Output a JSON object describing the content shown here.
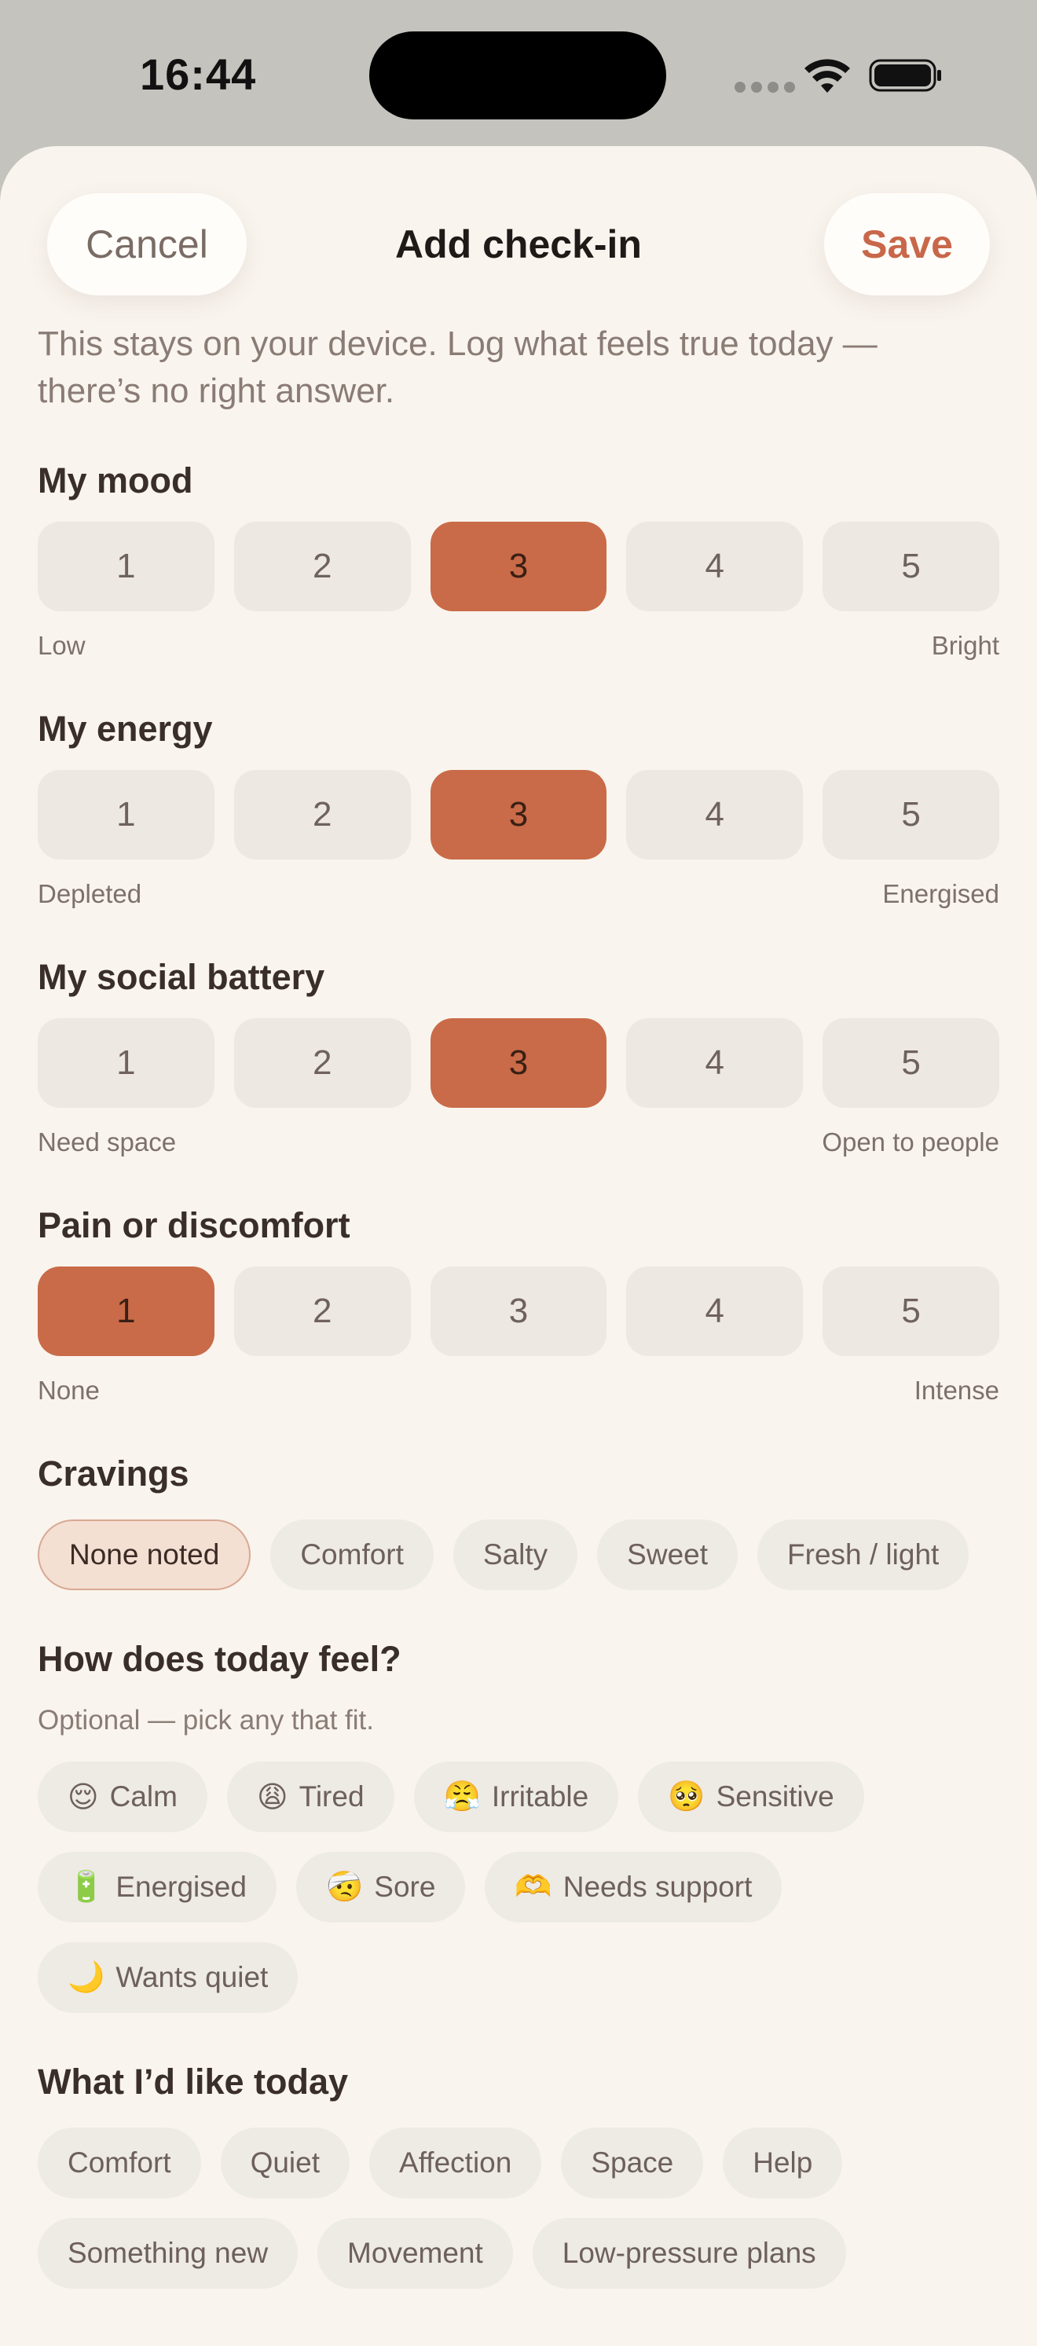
{
  "status_bar": {
    "time": "16:44"
  },
  "header": {
    "cancel_label": "Cancel",
    "title": "Add check-in",
    "save_label": "Save"
  },
  "intro": "This stays on your device. Log what feels true today — there’s no right answer.",
  "scales": {
    "mood": {
      "title": "My mood",
      "options": [
        "1",
        "2",
        "3",
        "4",
        "5"
      ],
      "selected": 3,
      "low_label": "Low",
      "high_label": "Bright"
    },
    "energy": {
      "title": "My energy",
      "options": [
        "1",
        "2",
        "3",
        "4",
        "5"
      ],
      "selected": 3,
      "low_label": "Depleted",
      "high_label": "Energised"
    },
    "social": {
      "title": "My social battery",
      "options": [
        "1",
        "2",
        "3",
        "4",
        "5"
      ],
      "selected": 3,
      "low_label": "Need space",
      "high_label": "Open to people"
    },
    "pain": {
      "title": "Pain or discomfort",
      "options": [
        "1",
        "2",
        "3",
        "4",
        "5"
      ],
      "selected": 1,
      "low_label": "None",
      "high_label": "Intense"
    }
  },
  "cravings": {
    "title": "Cravings",
    "options": [
      "None noted",
      "Comfort",
      "Salty",
      "Sweet",
      "Fresh / light"
    ],
    "selected": "None noted"
  },
  "feelings": {
    "title": "How does today feel?",
    "hint": "Optional — pick any that fit.",
    "options": [
      {
        "emoji": "😌",
        "label": "Calm"
      },
      {
        "emoji": "😩",
        "label": "Tired"
      },
      {
        "emoji": "😤",
        "label": "Irritable"
      },
      {
        "emoji": "🥺",
        "label": "Sensitive"
      },
      {
        "emoji": "🔋",
        "label": "Energised"
      },
      {
        "emoji": "🤕",
        "label": "Sore"
      },
      {
        "emoji": "🫶",
        "label": "Needs support"
      },
      {
        "emoji": "🌙",
        "label": "Wants quiet"
      }
    ]
  },
  "wishes": {
    "title": "What I’d like today",
    "options": [
      "Comfort",
      "Quiet",
      "Affection",
      "Space",
      "Help",
      "Something new",
      "Movement",
      "Low-pressure plans"
    ]
  },
  "colors": {
    "accent": "#c96b48",
    "background": "#f9f4ee",
    "chip": "#eeeae4"
  }
}
